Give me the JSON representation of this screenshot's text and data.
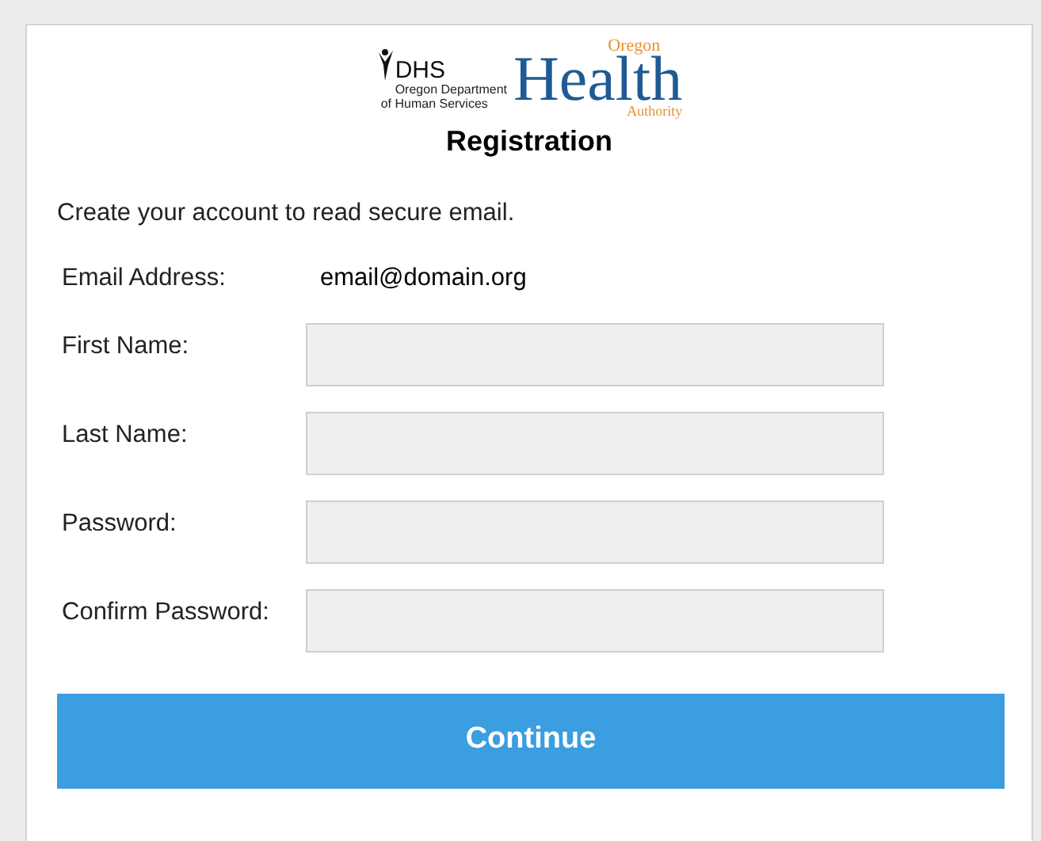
{
  "logo": {
    "dhs_title": "DHS",
    "dhs_line_1": "Oregon Department",
    "dhs_line_2": "of Human Services",
    "oha_top": "Oregon",
    "oha_main": "Health",
    "oha_bottom": "Authority"
  },
  "title": "Registration",
  "intro": "Create your account to read secure email.",
  "email": {
    "label": "Email Address:",
    "value": "email@domain.org"
  },
  "fields": [
    {
      "label": "First Name:"
    },
    {
      "label": "Last Name:"
    },
    {
      "label": "Password:"
    },
    {
      "label": "Confirm Password:"
    }
  ],
  "button": "Continue"
}
